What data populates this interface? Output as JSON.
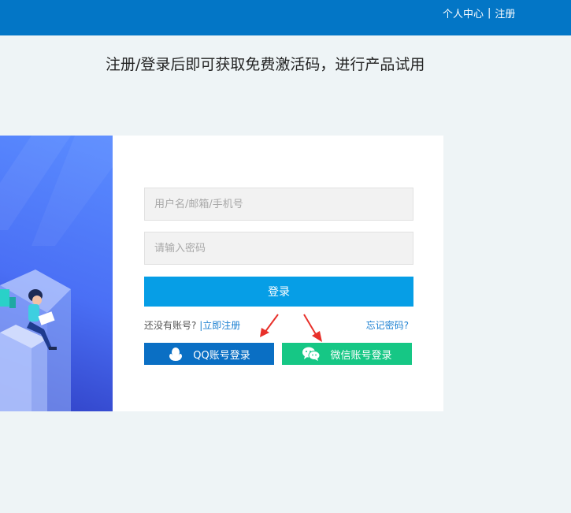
{
  "header": {
    "nav_user_center": "个人中心",
    "nav_separator": "|",
    "nav_register": "注册"
  },
  "headline": "注册/登录后即可获取免费激活码，进行产品试用",
  "form": {
    "username_placeholder": "用户名/邮箱/手机号",
    "password_placeholder": "请输入密码",
    "login_label": "登录",
    "no_account_text": "还没有账号?",
    "register_link": "|立即注册",
    "forgot_link": "忘记密码?",
    "qq_login_label": "QQ账号登录",
    "wechat_login_label": "微信账号登录"
  },
  "colors": {
    "header_bg": "#0376c6",
    "login_btn": "#069ee6",
    "qq_btn": "#0a6fc4",
    "wechat_btn": "#16c785",
    "annotation_arrow": "#e8302a"
  },
  "icons": [
    "qq-penguin-icon",
    "wechat-icon"
  ]
}
